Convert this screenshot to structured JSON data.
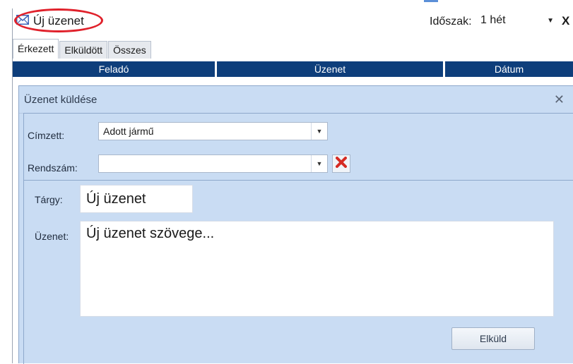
{
  "toolbar": {
    "new_message_label": "Új üzenet",
    "period_label": "Időszak:",
    "period_value": "1 hét",
    "close_label": "X"
  },
  "tabs": [
    {
      "label": "Érkezett",
      "active": true
    },
    {
      "label": "Elküldött",
      "active": false
    },
    {
      "label": "Összes",
      "active": false
    }
  ],
  "table": {
    "columns": [
      "Feladó",
      "Üzenet",
      "Dátum"
    ]
  },
  "dialog": {
    "title": "Üzenet küldése",
    "close_label": "X",
    "recipient_label": "Címzett:",
    "recipient_value": "Adott jármű",
    "plate_label": "Rendszám:",
    "plate_value": "",
    "subject_label": "Tárgy:",
    "subject_value": "Új üzenet",
    "message_label": "Üzenet:",
    "message_value": "Új üzenet szövege...",
    "send_label": "Elküld"
  },
  "colors": {
    "header_bar": "#0e3e7b",
    "dialog_bg": "#c9dcf3",
    "highlight_circle": "#e0212b",
    "clear_icon": "#d62b23"
  },
  "icons": {
    "new_message": "envelope-icon",
    "clear": "red-x-icon"
  }
}
